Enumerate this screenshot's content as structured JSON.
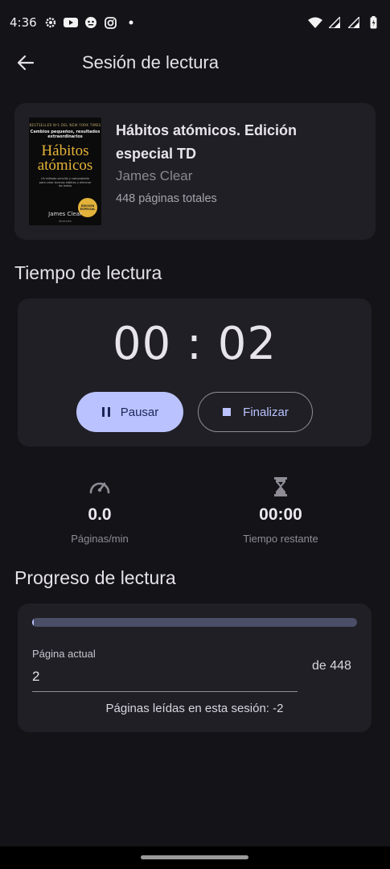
{
  "status_bar": {
    "time": "4:36",
    "left_icons": [
      "settings-icon",
      "youtube-icon",
      "game-controller-icon",
      "instagram-icon",
      "dot-icon"
    ],
    "right_icons": [
      "wifi-icon",
      "signal-icon",
      "signal-icon-2",
      "battery-icon"
    ]
  },
  "header": {
    "title": "Sesión de lectura",
    "back_icon": "arrow-back-icon"
  },
  "book": {
    "title": "Hábitos atómicos. Edición especial TD",
    "author": "James Clear",
    "pages": "448 páginas totales",
    "cover": {
      "top_line": "BESTSELLER Nº1 DEL NEW YORK TIMES",
      "subtitle": "Cambios pequeños, resultados extraordinarios",
      "title_line1": "Hábitos",
      "title_line2": "atómicos",
      "description": "Un método sencillo y comprobado para crear buenos hábitos y eliminar los malos",
      "seal": "EDICIÓN ESPECIAL",
      "author": "James Clear",
      "publisher": "diversión"
    }
  },
  "timer_section": {
    "title": "Tiempo de lectura",
    "time": "00 : 02",
    "pause_label": "Pausar",
    "finish_label": "Finalizar"
  },
  "stats": {
    "speed_value": "0.0",
    "speed_label": "Páginas/min",
    "remaining_value": "00:00",
    "remaining_label": "Tiempo restante"
  },
  "progress_section": {
    "title": "Progreso de lectura",
    "progress_fraction": 0.0045,
    "current_page_label": "Página actual",
    "current_page_value": "2",
    "of_total": "de 448",
    "session_pages": "Páginas leídas en esta sesión: -2"
  },
  "colors": {
    "background": "#131318",
    "card": "#1f1f25",
    "accent": "#bac3ff",
    "track": "#4a4e66"
  }
}
